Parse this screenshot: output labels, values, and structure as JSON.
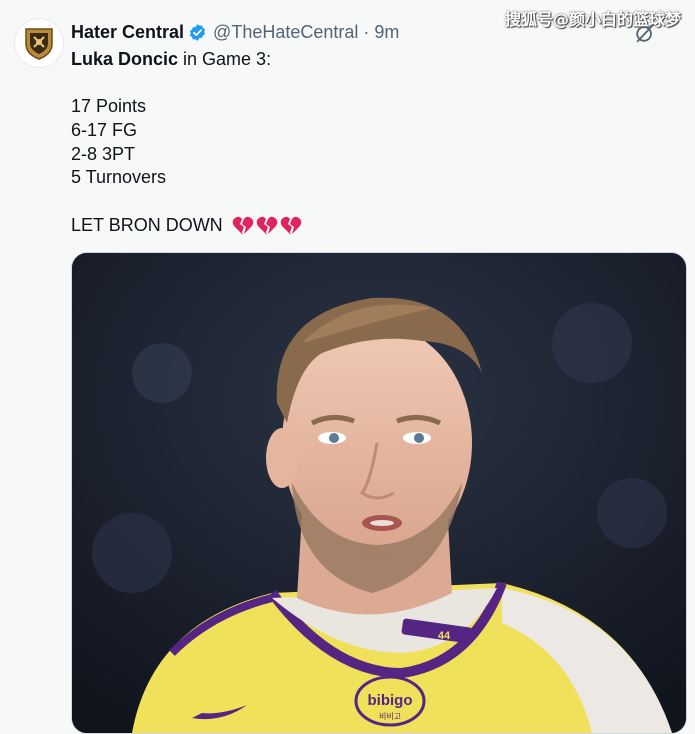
{
  "tweet": {
    "display_name": "Hater Central",
    "handle": "@TheHateCentral",
    "separator": "·",
    "time": "9m",
    "text": {
      "player_name": "Luka Doncic",
      "headline_rest": " in Game 3:",
      "stats": [
        "17 Points",
        "6-17 FG",
        "2-8 3PT",
        "5 Turnovers"
      ],
      "closer": "LET BRON DOWN"
    },
    "emoji_icons": [
      "broken-heart-icon",
      "broken-heart-icon",
      "broken-heart-icon"
    ],
    "jersey": {
      "sponsor": "bibigo",
      "sponsor_korean": "비비고",
      "number": "44"
    }
  },
  "watermark": "搜狐号@颜小白的篮球梦",
  "colors": {
    "verified": "#1d9bf0",
    "text": "#0f1419",
    "muted": "#536471",
    "heart": "#e0245e",
    "jersey": "#f1e05a",
    "jersey_trim": "#552583"
  }
}
